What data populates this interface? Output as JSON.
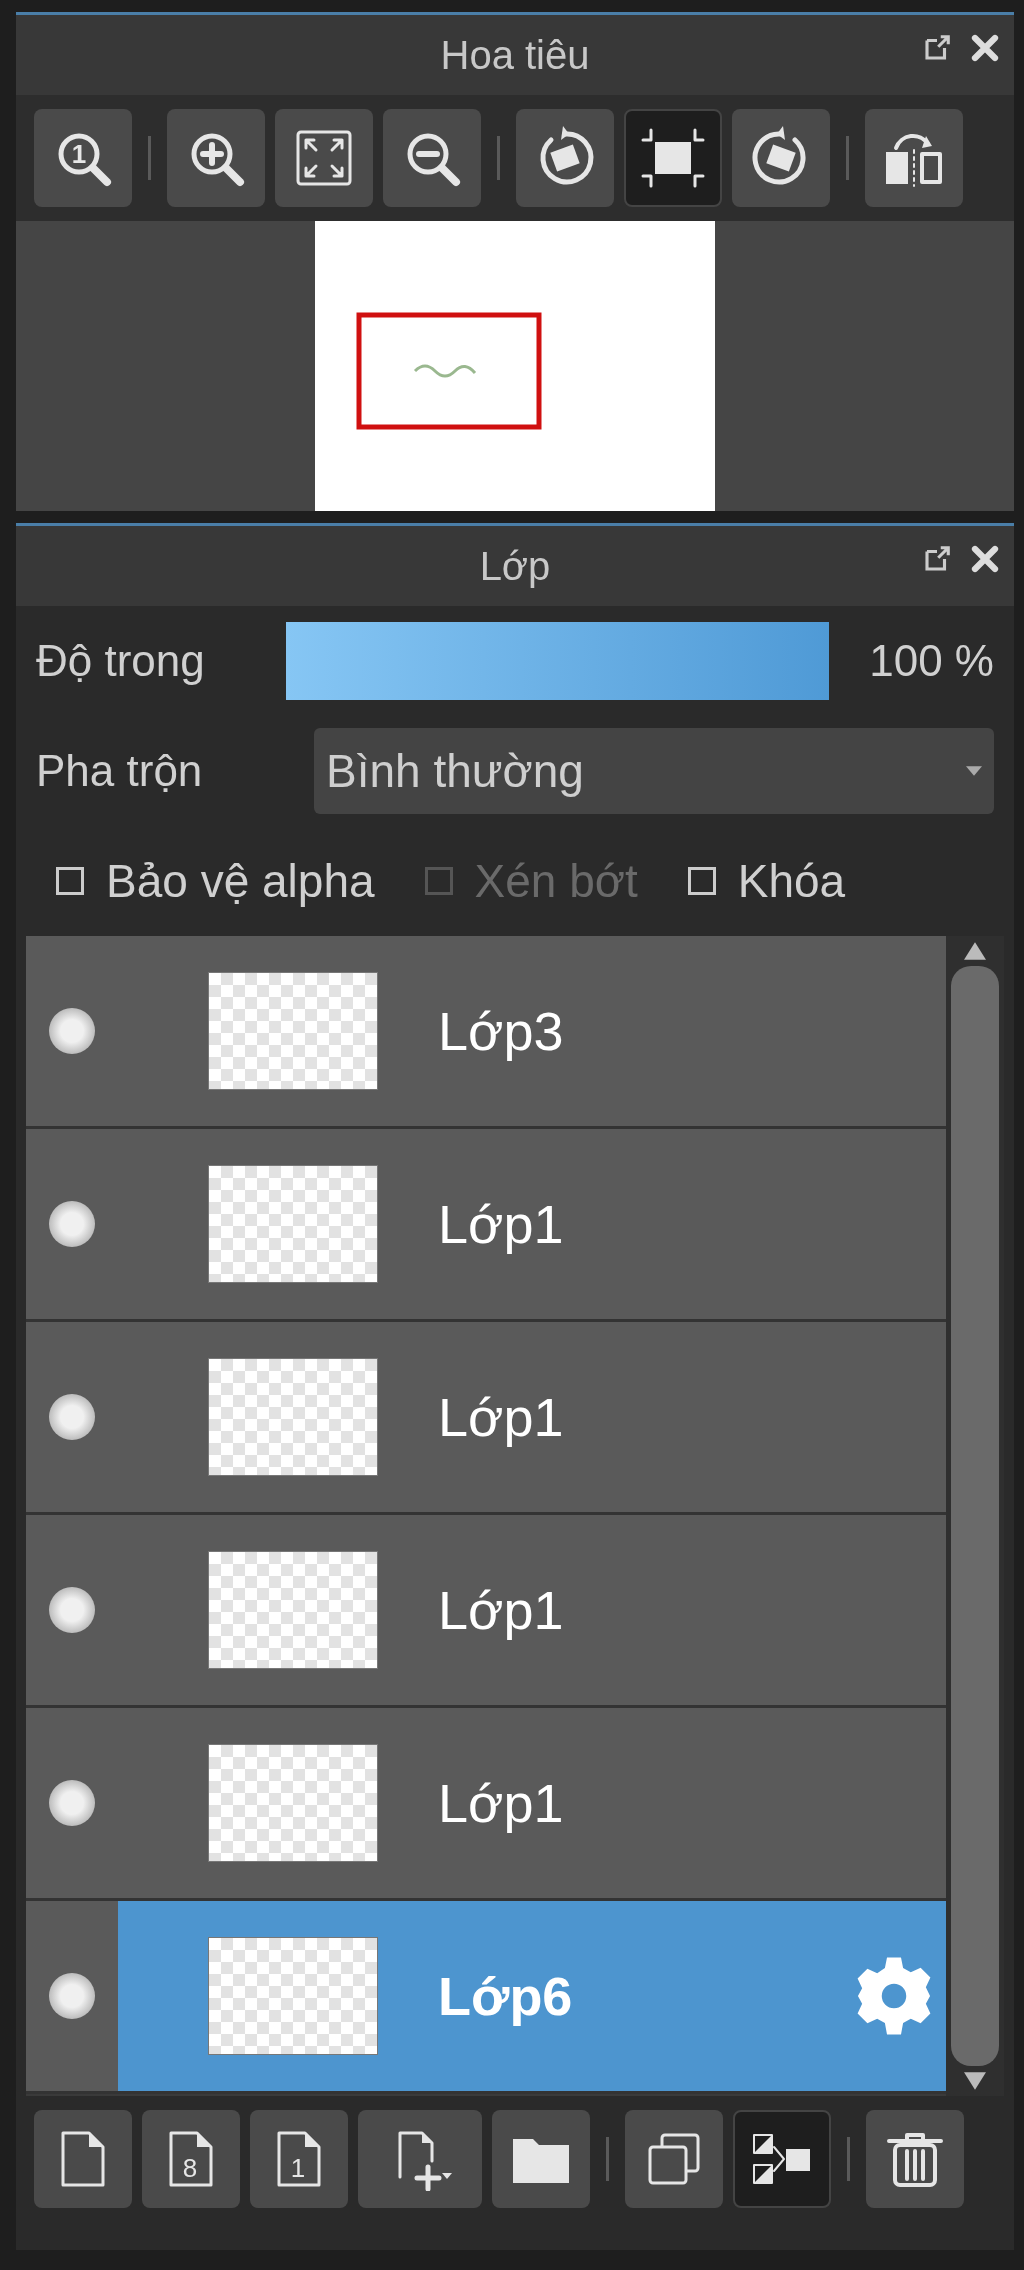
{
  "navigator": {
    "title": "Hoa tiêu",
    "toolbar": [
      [
        {
          "kind": "zoom-actual",
          "label": "1",
          "pressed": false
        }
      ],
      [
        {
          "kind": "zoom-in",
          "pressed": false
        },
        {
          "kind": "fit",
          "pressed": false
        },
        {
          "kind": "zoom-out",
          "pressed": false
        }
      ],
      [
        {
          "kind": "rotate-left",
          "pressed": false
        },
        {
          "kind": "fit-frame",
          "pressed": true
        },
        {
          "kind": "rotate-right",
          "pressed": false
        }
      ],
      [
        {
          "kind": "flip",
          "pressed": false
        }
      ]
    ],
    "preview": {
      "kind": "picture"
    }
  },
  "layers_panel": {
    "title": "Lớp",
    "opacity": {
      "label": "Độ trong",
      "level": 1,
      "reading": "100 %"
    },
    "blend": {
      "label": "Pha trộn",
      "value": "Bình thường"
    },
    "options": [
      {
        "label": "Bảo vệ alpha",
        "checked": false,
        "disabled": false
      },
      {
        "label": "Xén bớt",
        "checked": false,
        "disabled": true
      },
      {
        "label": "Khóa",
        "checked": false,
        "disabled": false
      }
    ],
    "layers": [
      {
        "name": "Lớp3",
        "visible": true,
        "selected": false
      },
      {
        "name": "Lớp1",
        "visible": true,
        "selected": false
      },
      {
        "name": "Lớp1",
        "visible": true,
        "selected": false
      },
      {
        "name": "Lớp1",
        "visible": true,
        "selected": false
      },
      {
        "name": "Lớp1",
        "visible": true,
        "selected": false
      },
      {
        "name": "Lớp6",
        "visible": true,
        "selected": true
      }
    ],
    "toolbar": [
      [
        {
          "kind": "new",
          "pressed": false
        },
        {
          "kind": "new-numbered",
          "label": "8",
          "pressed": false
        },
        {
          "kind": "new-numbered",
          "label": "1",
          "pressed": false
        },
        {
          "kind": "add-menu",
          "pressed": false
        },
        {
          "kind": "folder",
          "pressed": false
        }
      ],
      [
        {
          "kind": "duplicate",
          "pressed": false
        },
        {
          "kind": "merge",
          "pressed": true
        }
      ],
      [
        {
          "kind": "delete",
          "pressed": false
        }
      ]
    ]
  }
}
